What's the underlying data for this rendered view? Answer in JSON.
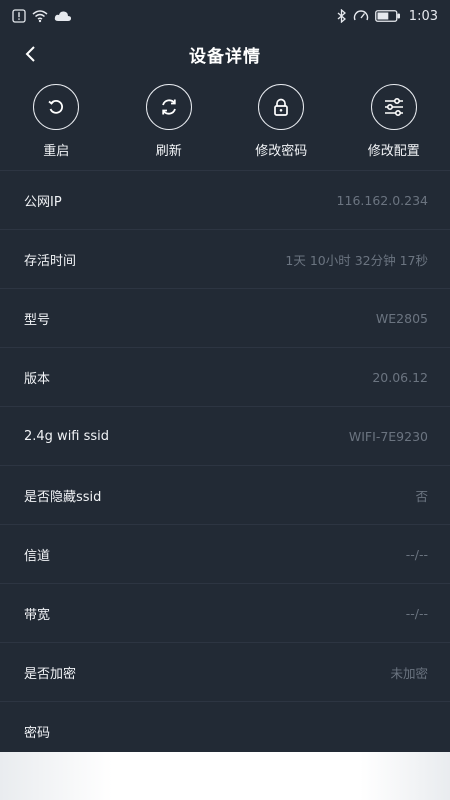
{
  "status_bar": {
    "time": "1:03",
    "battery_level": 0.6
  },
  "header": {
    "title": "设备详情"
  },
  "actions": [
    {
      "label": "重启",
      "icon": "restart-icon"
    },
    {
      "label": "刷新",
      "icon": "refresh-icon"
    },
    {
      "label": "修改密码",
      "icon": "lock-icon"
    },
    {
      "label": "修改配置",
      "icon": "sliders-icon"
    }
  ],
  "details": [
    {
      "label": "公网IP",
      "value": "116.162.0.234"
    },
    {
      "label": "存活时间",
      "value": "1天 10小时 32分钟 17秒"
    },
    {
      "label": "型号",
      "value": "WE2805"
    },
    {
      "label": "版本",
      "value": "20.06.12"
    },
    {
      "label": "2.4g wifi ssid",
      "value": "WIFI-7E9230"
    },
    {
      "label": "是否隐藏ssid",
      "value": "否"
    },
    {
      "label": "信道",
      "value": "--/--"
    },
    {
      "label": "带宽",
      "value": "--/--"
    },
    {
      "label": "是否加密",
      "value": "未加密"
    },
    {
      "label": "密码",
      "value": ""
    }
  ],
  "colors": {
    "background": "#222a35",
    "divider": "#2d3542",
    "value_text": "#6b7480"
  }
}
